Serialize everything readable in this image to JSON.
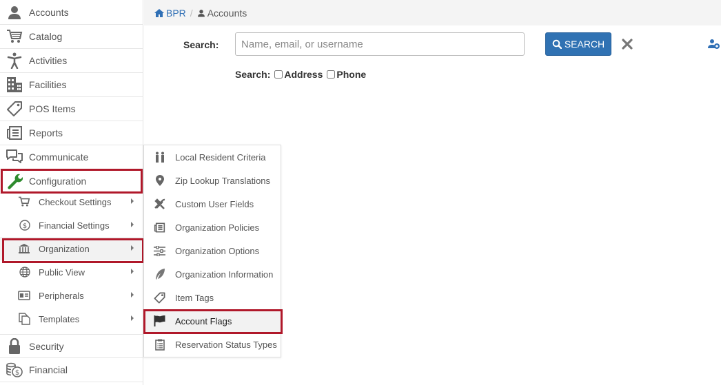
{
  "sidebar": {
    "items": [
      {
        "label": "Accounts",
        "icon": "user-icon"
      },
      {
        "label": "Catalog",
        "icon": "cart-icon"
      },
      {
        "label": "Activities",
        "icon": "person-icon"
      },
      {
        "label": "Facilities",
        "icon": "building-icon"
      },
      {
        "label": "POS Items",
        "icon": "tag-icon"
      },
      {
        "label": "Reports",
        "icon": "newspaper-icon"
      },
      {
        "label": "Communicate",
        "icon": "chat-icon"
      },
      {
        "label": "Configuration",
        "icon": "wrench-icon"
      },
      {
        "label": "Security",
        "icon": "lock-icon"
      },
      {
        "label": "Financial",
        "icon": "coins-icon"
      }
    ],
    "config_subitems": [
      {
        "label": "Checkout Settings",
        "icon": "cart-icon"
      },
      {
        "label": "Financial Settings",
        "icon": "dollar-circle-icon"
      },
      {
        "label": "Organization",
        "icon": "bank-icon"
      },
      {
        "label": "Public View",
        "icon": "globe-icon"
      },
      {
        "label": "Peripherals",
        "icon": "id-card-icon"
      },
      {
        "label": "Templates",
        "icon": "copy-icon"
      }
    ]
  },
  "breadcrumb": {
    "home": "BPR",
    "separator": "/",
    "current": "Accounts"
  },
  "search": {
    "label": "Search:",
    "placeholder": "Name, email, or username",
    "value": "",
    "button_label": "SEARCH",
    "options_label": "Search:",
    "options": [
      {
        "label": "Address",
        "checked": false
      },
      {
        "label": "Phone",
        "checked": false
      }
    ]
  },
  "flyout": {
    "items": [
      {
        "label": "Local Resident Criteria",
        "icon": "people-icon"
      },
      {
        "label": "Zip Lookup Translations",
        "icon": "map-marker-icon"
      },
      {
        "label": "Custom User Fields",
        "icon": "tools-icon"
      },
      {
        "label": "Organization Policies",
        "icon": "newspaper-icon"
      },
      {
        "label": "Organization Options",
        "icon": "sliders-icon"
      },
      {
        "label": "Organization Information",
        "icon": "feather-icon"
      },
      {
        "label": "Item Tags",
        "icon": "tag-icon"
      },
      {
        "label": "Account Flags",
        "icon": "flag-icon"
      },
      {
        "label": "Reservation Status Types",
        "icon": "clipboard-icon"
      }
    ]
  },
  "colors": {
    "accent": "#3072b3",
    "highlight": "#b0182a",
    "wrench": "#2e8b2e"
  }
}
